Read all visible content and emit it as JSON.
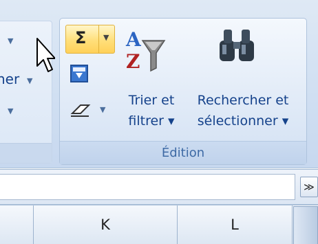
{
  "ribbon": {
    "left_group": {
      "item2_label": "ner"
    },
    "edition_group": {
      "label": "Édition",
      "autosum": {
        "icon": "sigma-icon"
      },
      "fill": {
        "icon": "fill-down-icon"
      },
      "clear": {
        "icon": "eraser-icon"
      },
      "sort_filter": {
        "line1": "Trier et",
        "line2": "filtrer ▾",
        "icon": "sort-az-filter-icon"
      },
      "find_select": {
        "line1": "Rechercher et",
        "line2": "sélectionner ▾",
        "icon": "binoculars-icon"
      }
    }
  },
  "formula_bar": {
    "value": "",
    "expand_glyph": "≫"
  },
  "columns": {
    "k": "K",
    "l": "L"
  },
  "colors": {
    "ribbon_text": "#15428b",
    "group_label": "#3e6aa5",
    "highlight": "#ffdf7a"
  }
}
